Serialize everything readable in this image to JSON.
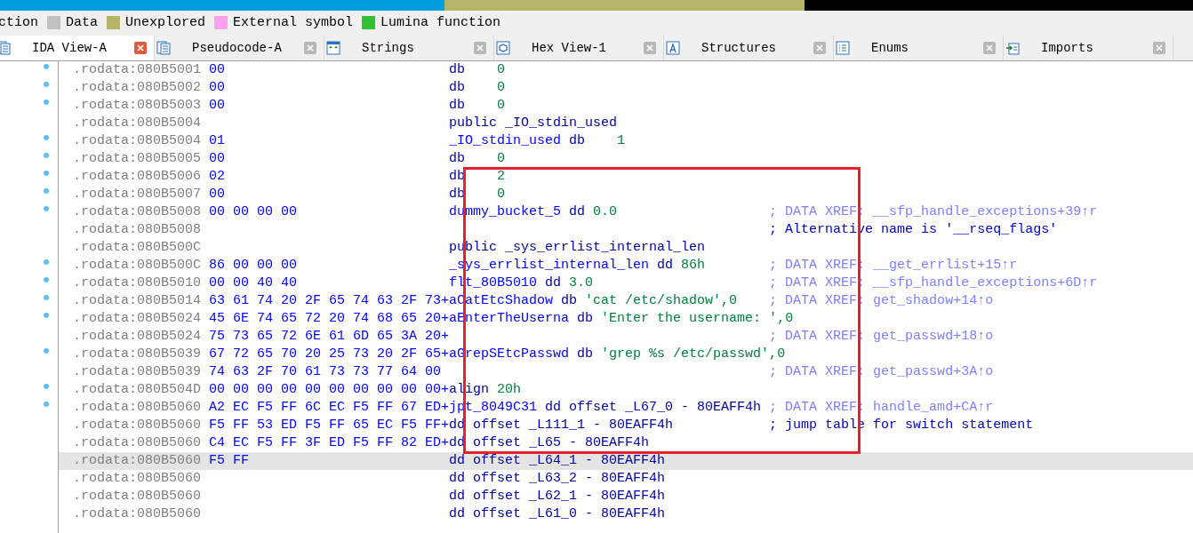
{
  "legend": [
    {
      "label": "ction"
    },
    {
      "label": "Data",
      "color": "#c0c0c0"
    },
    {
      "label": "Unexplored",
      "color": "#b5b56a"
    },
    {
      "label": "External symbol",
      "color": "#ffa0f0"
    },
    {
      "label": "Lumina function",
      "color": "#30c030"
    }
  ],
  "tabs": [
    {
      "label": "IDA View-A",
      "selected": true
    },
    {
      "label": "Pseudocode-A",
      "selected": false
    },
    {
      "label": "Strings",
      "selected": false
    },
    {
      "label": "Hex View-1",
      "selected": false
    },
    {
      "label": "Structures",
      "selected": false
    },
    {
      "label": "Enums",
      "selected": false
    },
    {
      "label": "Imports",
      "selected": false
    }
  ],
  "rows": [
    {
      "address": ".rodata:080B5001",
      "bytes": "00",
      "dot": true,
      "selected": false,
      "code": [
        {
          "text": "db    ",
          "kind": "op"
        },
        {
          "text": "0",
          "kind": "num"
        }
      ]
    },
    {
      "address": ".rodata:080B5002",
      "bytes": "00",
      "dot": true,
      "selected": false,
      "code": [
        {
          "text": "db    ",
          "kind": "op"
        },
        {
          "text": "0",
          "kind": "num"
        }
      ]
    },
    {
      "address": ".rodata:080B5003",
      "bytes": "00",
      "dot": true,
      "selected": false,
      "code": [
        {
          "text": "db    ",
          "kind": "op"
        },
        {
          "text": "0",
          "kind": "num"
        }
      ]
    },
    {
      "address": ".rodata:080B5004",
      "dot": false,
      "selected": false,
      "code": [
        {
          "text": "public _IO_stdin_used",
          "kind": "op"
        }
      ]
    },
    {
      "address": ".rodata:080B5004",
      "bytes": "01",
      "dot": true,
      "selected": false,
      "code": [
        {
          "text": "_IO_stdin_used ",
          "kind": "name"
        },
        {
          "text": "db    ",
          "kind": "op"
        },
        {
          "text": "1",
          "kind": "num"
        }
      ]
    },
    {
      "address": ".rodata:080B5005",
      "bytes": "00",
      "dot": true,
      "selected": false,
      "code": [
        {
          "text": "db    ",
          "kind": "op"
        },
        {
          "text": "0",
          "kind": "num"
        }
      ]
    },
    {
      "address": ".rodata:080B5006",
      "bytes": "02",
      "dot": true,
      "selected": false,
      "code": [
        {
          "text": "db    ",
          "kind": "op"
        },
        {
          "text": "2",
          "kind": "num"
        }
      ]
    },
    {
      "address": ".rodata:080B5007",
      "bytes": "00",
      "dot": true,
      "selected": false,
      "code": [
        {
          "text": "db    ",
          "kind": "op"
        },
        {
          "text": "0",
          "kind": "num"
        }
      ]
    },
    {
      "address": ".rodata:080B5008",
      "bytes": "00 00 00 00",
      "dot": true,
      "selected": false,
      "code": [
        {
          "text": "dummy_bucket_5 ",
          "kind": "name"
        },
        {
          "text": "dd ",
          "kind": "op"
        },
        {
          "text": "0.0",
          "kind": "num"
        }
      ],
      "comment": {
        "text": "; DATA XREF: __sfp_handle_exceptions+39↑r",
        "kind": "xref"
      }
    },
    {
      "address": ".rodata:080B5008",
      "dot": false,
      "selected": false,
      "comment": {
        "text": "; Alternative name is '__rseq_flags'",
        "kind": "note"
      }
    },
    {
      "address": ".rodata:080B500C",
      "dot": false,
      "selected": false,
      "code": [
        {
          "text": "public _sys_errlist_internal_len",
          "kind": "op"
        }
      ]
    },
    {
      "address": ".rodata:080B500C",
      "bytes": "86 00 00 00",
      "dot": true,
      "selected": false,
      "code": [
        {
          "text": "_sys_errlist_internal_len ",
          "kind": "name"
        },
        {
          "text": "dd ",
          "kind": "op"
        },
        {
          "text": "86h",
          "kind": "num"
        }
      ],
      "comment": {
        "text": "; DATA XREF: __get_errlist+15↑r",
        "kind": "xref"
      }
    },
    {
      "address": ".rodata:080B5010",
      "bytes": "00 00 40 40",
      "dot": true,
      "selected": false,
      "code": [
        {
          "text": "flt_80B5010 ",
          "kind": "name"
        },
        {
          "text": "dd ",
          "kind": "op"
        },
        {
          "text": "3.0",
          "kind": "num"
        }
      ],
      "comment": {
        "text": "; DATA XREF: __sfp_handle_exceptions+6D↑r",
        "kind": "xref"
      }
    },
    {
      "address": ".rodata:080B5014",
      "bytes": "63 61 74 20 2F 65 74 63 2F 73+",
      "dot": true,
      "selected": false,
      "code": [
        {
          "text": "aCatEtcShadow ",
          "kind": "name"
        },
        {
          "text": "db ",
          "kind": "op"
        },
        {
          "text": "'cat /etc/shadow',0",
          "kind": "str"
        }
      ],
      "comment": {
        "text": "; DATA XREF: get_shadow+14↑o",
        "kind": "xref"
      }
    },
    {
      "address": ".rodata:080B5024",
      "bytes": "45 6E 74 65 72 20 74 68 65 20+",
      "dot": true,
      "selected": false,
      "code": [
        {
          "text": "aEnterTheUserna ",
          "kind": "name"
        },
        {
          "text": "db ",
          "kind": "op"
        },
        {
          "text": "'Enter the username: ',0",
          "kind": "str"
        }
      ]
    },
    {
      "address": ".rodata:080B5024",
      "bytes": "75 73 65 72 6E 61 6D 65 3A 20+",
      "dot": false,
      "selected": false,
      "comment": {
        "text": "; DATA XREF: get_passwd+18↑o",
        "kind": "xref"
      }
    },
    {
      "address": ".rodata:080B5039",
      "bytes": "67 72 65 70 20 25 73 20 2F 65+",
      "dot": true,
      "selected": false,
      "code": [
        {
          "text": "aGrepSEtcPasswd ",
          "kind": "name"
        },
        {
          "text": "db ",
          "kind": "op"
        },
        {
          "text": "'grep %s /etc/passwd',0",
          "kind": "str"
        }
      ]
    },
    {
      "address": ".rodata:080B5039",
      "bytes": "74 63 2F 70 61 73 73 77 64 00",
      "dot": false,
      "selected": false,
      "comment": {
        "text": "; DATA XREF: get_passwd+3A↑o",
        "kind": "xref"
      }
    },
    {
      "address": ".rodata:080B504D",
      "bytes": "00 00 00 00 00 00 00 00 00 00+",
      "dot": true,
      "selected": false,
      "code": [
        {
          "text": "align ",
          "kind": "op"
        },
        {
          "text": "20h",
          "kind": "num"
        }
      ]
    },
    {
      "address": ".rodata:080B5060",
      "bytes": "A2 EC F5 FF 6C EC F5 FF 67 ED+",
      "dot": true,
      "selected": false,
      "code": [
        {
          "text": "jpt_8049C31 ",
          "kind": "name"
        },
        {
          "text": "dd offset _L67_0 - 80EAFF4h",
          "kind": "op"
        }
      ],
      "comment": {
        "text": "; DATA XREF: handle_amd+CA↑r",
        "kind": "xref"
      }
    },
    {
      "address": ".rodata:080B5060",
      "bytes": "F5 FF 53 ED F5 FF 65 EC F5 FF+",
      "dot": false,
      "selected": false,
      "code": [
        {
          "text": "dd offset _L111_1 - 80EAFF4h",
          "kind": "op"
        }
      ],
      "comment": {
        "text": "; jump table for switch statement",
        "kind": "note"
      }
    },
    {
      "address": ".rodata:080B5060",
      "bytes": "C4 EC F5 FF 3F ED F5 FF 82 ED+",
      "dot": false,
      "selected": false,
      "code": [
        {
          "text": "dd offset _L65 - 80EAFF4h",
          "kind": "op"
        }
      ]
    },
    {
      "address": ".rodata:080B5060",
      "bytes": "F5 FF",
      "dot": false,
      "selected": true,
      "code": [
        {
          "text": "dd offset _L64_1 - 80EAFF4h",
          "kind": "op"
        }
      ]
    },
    {
      "address": ".rodata:080B5060",
      "dot": false,
      "selected": false,
      "code": [
        {
          "text": "dd offset _L63_2 - 80EAFF4h",
          "kind": "op"
        }
      ]
    },
    {
      "address": ".rodata:080B5060",
      "dot": false,
      "selected": false,
      "code": [
        {
          "text": "dd offset _L62_1 - 80EAFF4h",
          "kind": "op"
        }
      ]
    },
    {
      "address": ".rodata:080B5060",
      "dot": false,
      "selected": false,
      "code": [
        {
          "text": "dd offset _L61_0 - 80EAFF4h",
          "kind": "op"
        }
      ]
    }
  ]
}
